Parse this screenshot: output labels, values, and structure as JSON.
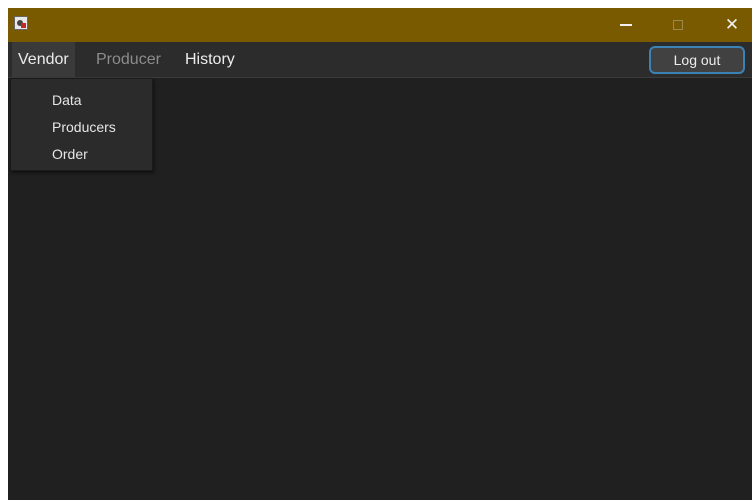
{
  "titlebar": {
    "app_icon": "app-icon",
    "controls": {
      "minimize": "minimize-icon",
      "maximize": "maximize-icon",
      "close": "close-icon",
      "close_glyph": "✕"
    },
    "background": "#7a5a00"
  },
  "menubar": {
    "menus": [
      {
        "label": "Vendor",
        "state": "open"
      },
      {
        "label": "Producer",
        "state": "disabled"
      },
      {
        "label": "History",
        "state": "normal"
      }
    ],
    "logout_label": "Log out"
  },
  "dropdown": {
    "items": [
      {
        "label": "Data"
      },
      {
        "label": "Producers"
      },
      {
        "label": "Order"
      }
    ]
  },
  "colors": {
    "content_bg": "#202020",
    "accent_border": "#3b82b5"
  }
}
